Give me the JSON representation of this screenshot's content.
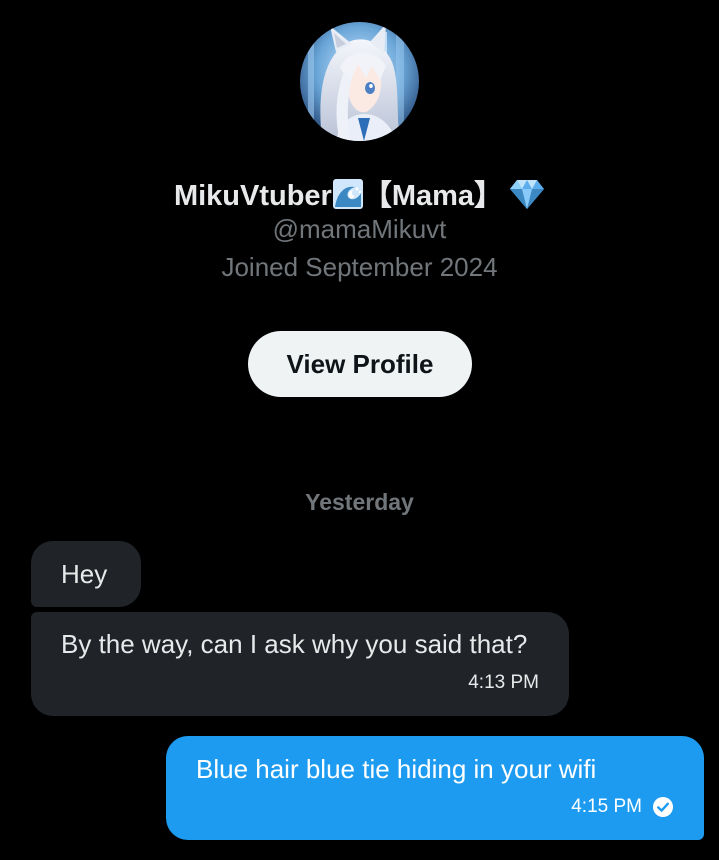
{
  "profile": {
    "display_name": "MikuVtuber",
    "name_suffix": "【Mama】",
    "handle": "@mamaMikuvt",
    "joined": "Joined September 2024",
    "view_profile_label": "View Profile",
    "avatar_icon": "avatar-anime-character",
    "name_emoji_1": "water-wave-icon",
    "name_emoji_2": "gem-stone-icon"
  },
  "conversation": {
    "date_divider": "Yesterday",
    "messages": [
      {
        "direction": "incoming",
        "text": "Hey",
        "time": ""
      },
      {
        "direction": "incoming",
        "text": "By the way, can I ask why you said that?",
        "time": "4:13 PM"
      },
      {
        "direction": "outgoing",
        "text": "Blue hair blue tie hiding in your wifi",
        "time": "4:15 PM",
        "status_icon": "read-check-icon"
      }
    ]
  },
  "colors": {
    "background": "#000000",
    "incoming_bubble": "#202327",
    "outgoing_bubble": "#1d9bf0",
    "secondary_text": "#71767b",
    "button_bg": "#eff3f4"
  }
}
